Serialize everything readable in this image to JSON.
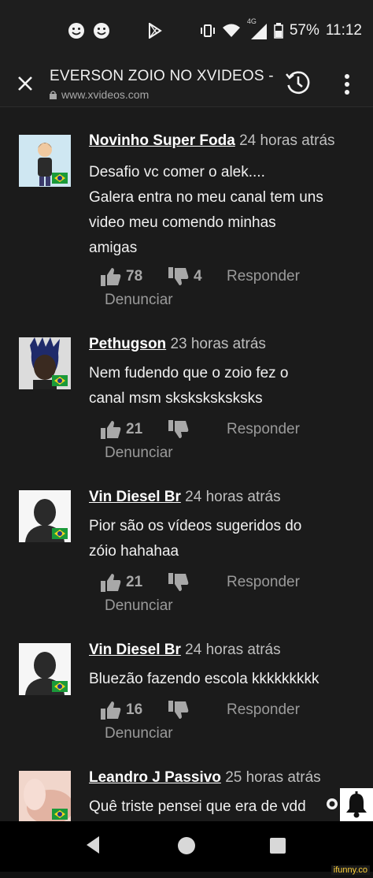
{
  "status_bar": {
    "battery": "57%",
    "time": "11:12",
    "network": "4G"
  },
  "browser": {
    "title": "EVERSON ZOIO NO XVIDEOS -",
    "url": "www.xvideos.com"
  },
  "comments": [
    {
      "author": "Novinho Super Foda",
      "time": "24 horas atrás",
      "text": [
        "Desafio vc comer o alek....",
        "Galera entra no meu canal tem uns",
        "video meu comendo minhas",
        "amigas"
      ],
      "likes": "78",
      "dislikes": "4",
      "reply": "Responder",
      "report": "Denunciar"
    },
    {
      "author": "Pethugson",
      "time": "23 horas atrás",
      "text": [
        "Nem fudendo que o zoio fez o",
        "canal msm sksksksksksks"
      ],
      "likes": "21",
      "dislikes": "",
      "reply": "Responder",
      "report": "Denunciar"
    },
    {
      "author": "Vin Diesel Br",
      "time": "24 horas atrás",
      "text": [
        "Pior são os vídeos sugeridos do",
        "zóio hahahaa"
      ],
      "likes": "21",
      "dislikes": "",
      "reply": "Responder",
      "report": "Denunciar"
    },
    {
      "author": "Vin Diesel Br",
      "time": "24 horas atrás",
      "text": [
        "Bluezão fazendo escola kkkkkkkkk"
      ],
      "likes": "16",
      "dislikes": "",
      "reply": "Responder",
      "report": "Denunciar"
    },
    {
      "author": "Leandro J Passivo",
      "time": "25 horas atrás",
      "text": [
        "Quê triste pensei que era de vdd"
      ],
      "likes": "",
      "dislikes": "",
      "reply": "",
      "report": ""
    }
  ],
  "watermark": "ifunny.co",
  "icons": [
    "smiley-icon",
    "play-store-icon",
    "vibrate-icon",
    "wifi-icon",
    "signal-icon",
    "battery-icon",
    "close-icon",
    "lock-icon",
    "history-icon",
    "more-vert-icon",
    "thumbs-up-icon",
    "thumbs-down-icon",
    "bell-icon",
    "back-icon",
    "home-icon",
    "recents-icon"
  ]
}
